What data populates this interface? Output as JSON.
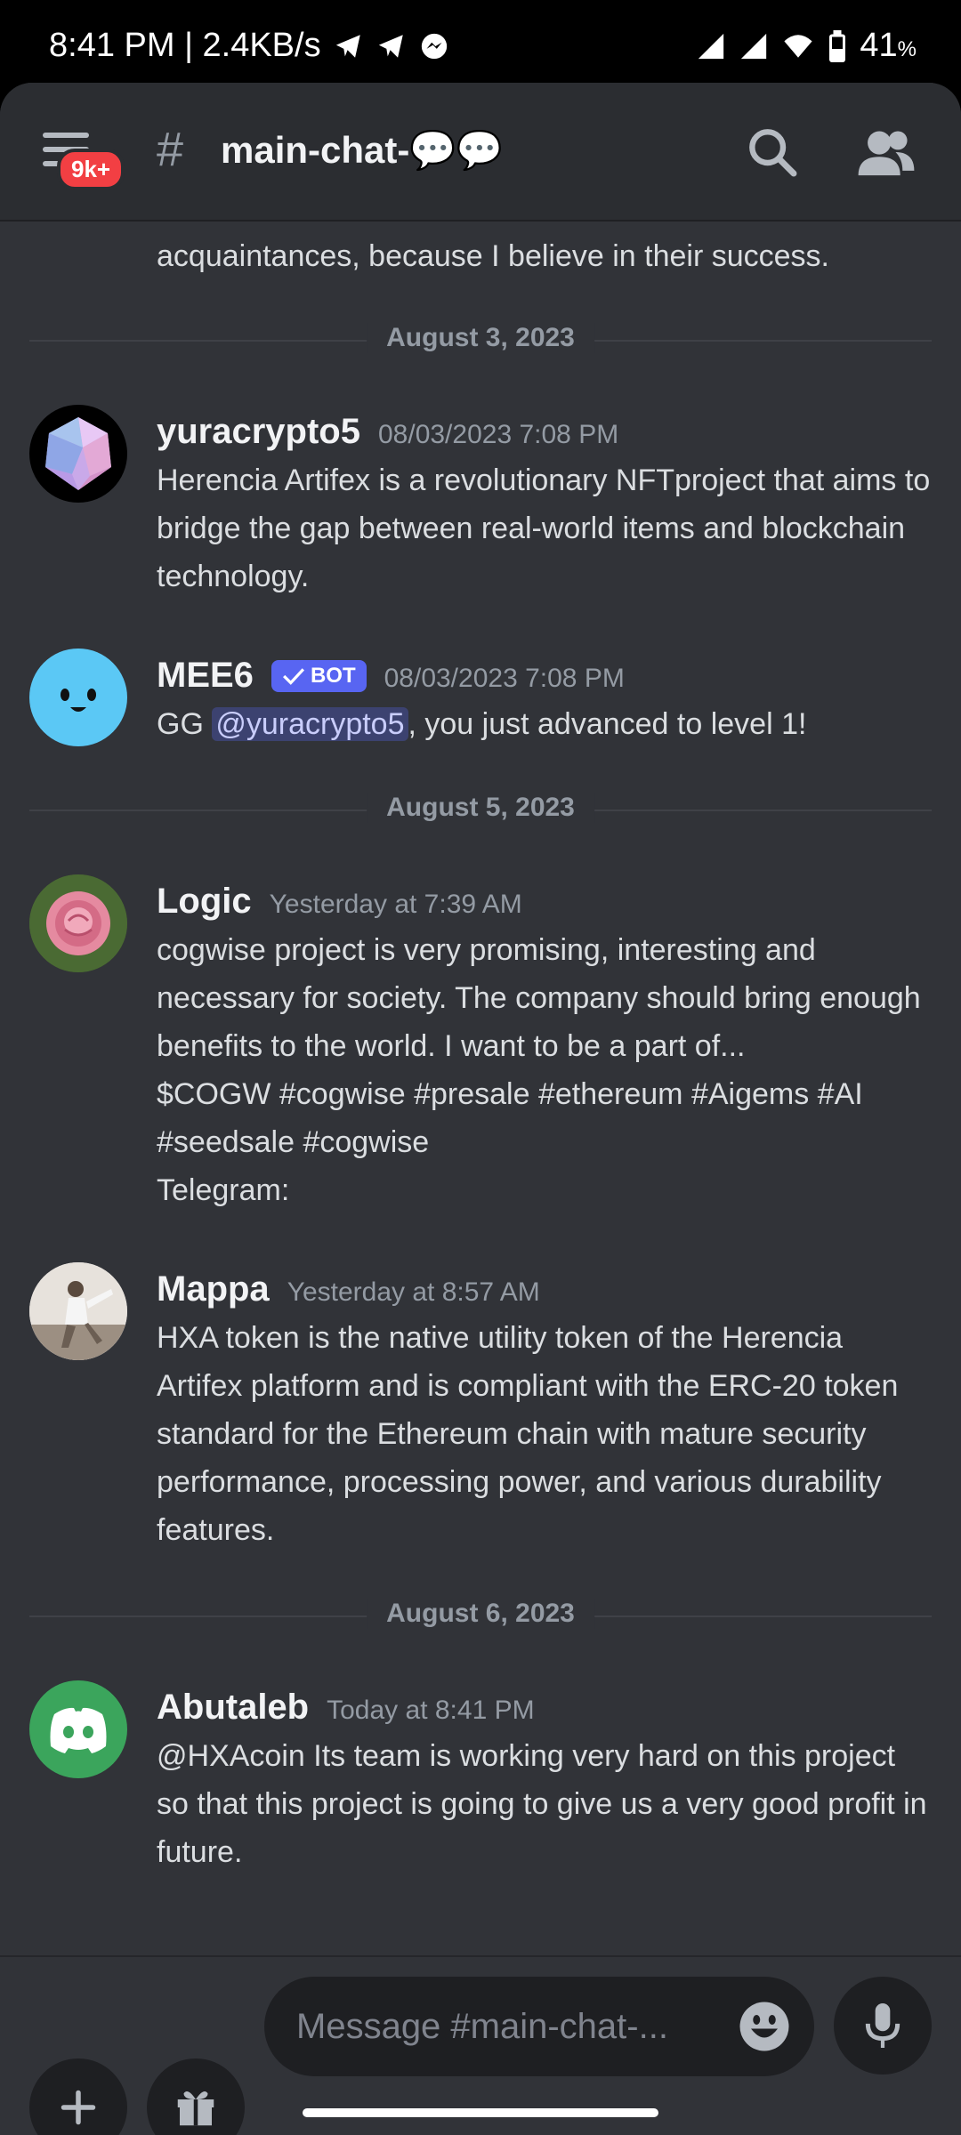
{
  "status_bar": {
    "time_speed": "8:41 PM | 2.4KB/s",
    "battery": "41",
    "battery_unit": "%"
  },
  "header": {
    "badge": "9k+",
    "hash": "#",
    "channel": "main-chat-💬💬"
  },
  "feed": {
    "top_partial_text": "acquaintances, because I believe in their success.",
    "dividers": [
      "August 3, 2023",
      "August 5, 2023",
      "August 6, 2023"
    ],
    "messages": [
      {
        "username": "yuracrypto5",
        "timestamp": "08/03/2023 7:08 PM",
        "text": "Herencia Artifex is a revolutionary NFTproject that aims to bridge the gap between real-world items and blockchain technology."
      },
      {
        "username": "MEE6",
        "bot_tag": "BOT",
        "timestamp": "08/03/2023 7:08 PM",
        "text_before": "GG ",
        "mention": "@yuracrypto5",
        "text_after": ", you just advanced to level 1!"
      },
      {
        "username": "Logic",
        "timestamp": "Yesterday at 7:39 AM",
        "line1": "cogwise project is very promising, interesting and necessary for society. The company should bring enough benefits to the world. I want to be a part of...",
        "line2": "$COGW #cogwise #presale #ethereum #Aigems #AI #seedsale #cogwise",
        "line3": "Telegram:"
      },
      {
        "username": "Mappa",
        "timestamp": "Yesterday at 8:57 AM",
        "text": "HXA token is the native utility token of the Herencia Artifex platform and is compliant with the ERC-20 token standard for the Ethereum chain with mature security performance, processing power, and various durability features."
      },
      {
        "username": "Abutaleb",
        "timestamp": "Today at 8:41 PM",
        "text": "@HXAcoin Its team is working very hard on this project so that this project is going to give us a very good profit in future."
      }
    ]
  },
  "composer": {
    "placeholder": "Message #main-chat-..."
  },
  "icons": {
    "status": [
      "telegram-icon",
      "telegram-icon",
      "messenger-icon",
      "signal-icon",
      "wifi-icon",
      "battery-icon"
    ],
    "header": [
      "menu-icon",
      "search-icon",
      "members-icon"
    ],
    "composer": [
      "plus-icon",
      "gift-icon",
      "emoji-icon",
      "microphone-icon"
    ]
  },
  "colors": {
    "background": "#313338",
    "header": "#2b2d31",
    "badge": "#f23f43",
    "bot_tag": "#5865f2",
    "mee6_avatar": "#5bc8f5",
    "discord_green": "#3ba55c"
  }
}
